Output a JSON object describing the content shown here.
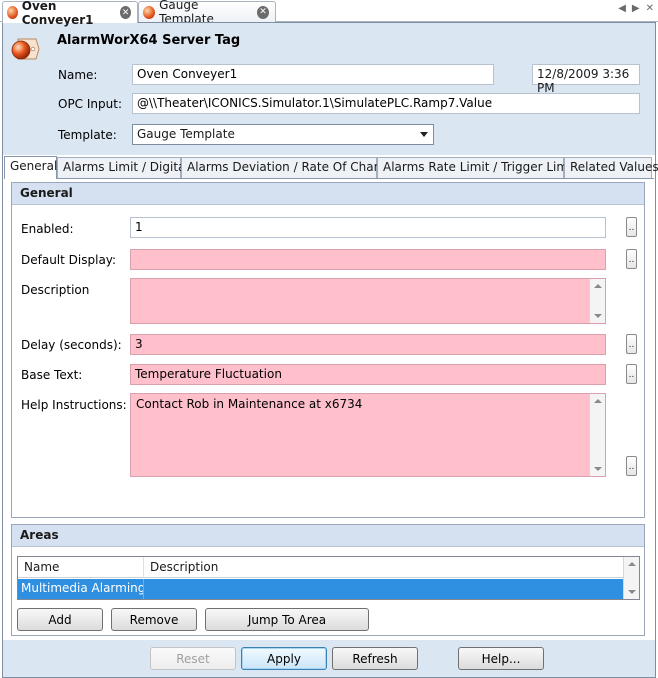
{
  "doc_tabs": [
    {
      "label": "Oven Conveyer1",
      "active": true
    },
    {
      "label": "Gauge Template",
      "active": false
    }
  ],
  "header": {
    "title": "AlarmWorX64 Server Tag",
    "name_label": "Name:",
    "name_value": "Oven Conveyer1",
    "timestamp": "12/8/2009 3:36 PM",
    "opc_label": "OPC Input:",
    "opc_value": "@\\\\Theater\\ICONICS.Simulator.1\\SimulatePLC.Ramp7.Value",
    "template_label": "Template:",
    "template_value": "Gauge Template"
  },
  "tabs": [
    {
      "label": "General",
      "active": true
    },
    {
      "label": "Alarms Limit / Digital"
    },
    {
      "label": "Alarms Deviation / Rate Of Change"
    },
    {
      "label": "Alarms Rate Limit  / Trigger Limit"
    },
    {
      "label": "Related Values"
    }
  ],
  "general": {
    "section_title": "General",
    "enabled_label": "Enabled:",
    "enabled_value": "1",
    "default_display_label": "Default Display:",
    "default_display_value": "",
    "description_label": "Description",
    "description_value": "",
    "delay_label": "Delay (seconds):",
    "delay_value": "3",
    "base_text_label": "Base Text:",
    "base_text_value": "Temperature Fluctuation",
    "help_label": "Help Instructions:",
    "help_value": "Contact Rob in Maintenance at  x6734",
    "ellipsis": ".."
  },
  "areas": {
    "section_title": "Areas",
    "columns": [
      "Name",
      "Description"
    ],
    "rows": [
      {
        "name": "Multimedia Alarming\\",
        "description": ""
      }
    ],
    "add_label": "Add",
    "remove_label": "Remove",
    "jump_label": "Jump To Area"
  },
  "footer": {
    "reset_label": "Reset",
    "apply_label": "Apply",
    "refresh_label": "Refresh",
    "help_label": "Help..."
  }
}
